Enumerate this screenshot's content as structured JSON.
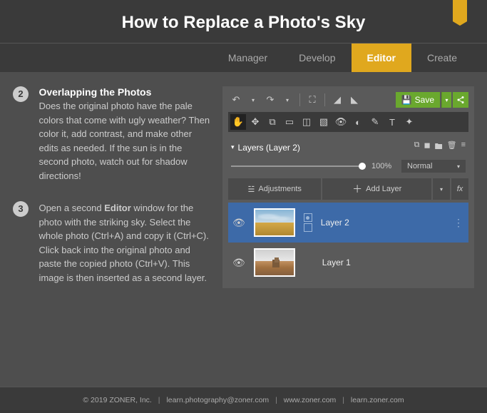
{
  "header": {
    "title": "How to Replace a Photo's Sky"
  },
  "tabs": [
    {
      "label": "Manager",
      "active": false
    },
    {
      "label": "Develop",
      "active": false
    },
    {
      "label": "Editor",
      "active": true
    },
    {
      "label": "Create",
      "active": false
    }
  ],
  "steps": [
    {
      "num": "2",
      "title": "Overlapping the Photos",
      "body": "Does the original photo have the pale colors that come with ugly weather? Then color it, add contrast, and make other edits as needed. If the sun is in the second photo, watch out for shadow directions!"
    },
    {
      "num": "3",
      "title": "",
      "body_pre": "Open a second ",
      "body_bold": "Editor",
      "body_post": " window for the photo with the striking sky. Select the whole photo (Ctrl+A) and copy it (Ctrl+C). Click back into the original photo and paste the copied photo (Ctrl+V). This image is then inserted as a second layer."
    }
  ],
  "panel": {
    "save_label": "Save",
    "layers_header": "Layers (Layer 2)",
    "opacity_pct": "100%",
    "blend_mode": "Normal",
    "adjustments_label": "Adjustments",
    "add_layer_label": "Add Layer",
    "fx_label": "fx",
    "layers": [
      {
        "name": "Layer 2",
        "selected": true
      },
      {
        "name": "Layer 1",
        "selected": false
      }
    ]
  },
  "footer": {
    "copyright": "© 2019 ZONER, Inc.",
    "email": "learn.photography@zoner.com",
    "url1": "www.zoner.com",
    "url2": "learn.zoner.com"
  }
}
